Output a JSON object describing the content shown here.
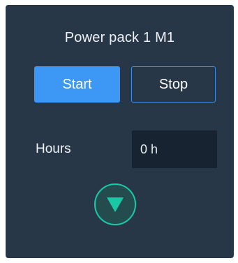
{
  "panel": {
    "title": "Power pack 1 M1",
    "start_label": "Start",
    "stop_label": "Stop",
    "hours_label": "Hours",
    "hours_value": "0 h",
    "expand_icon": "triangle-down-icon"
  },
  "colors": {
    "panel_bg": "#283748",
    "start_fill": "#3d97f5",
    "stop_border": "#3f8ce2",
    "field_bg": "#172331",
    "accent_teal": "#19c9a5"
  }
}
